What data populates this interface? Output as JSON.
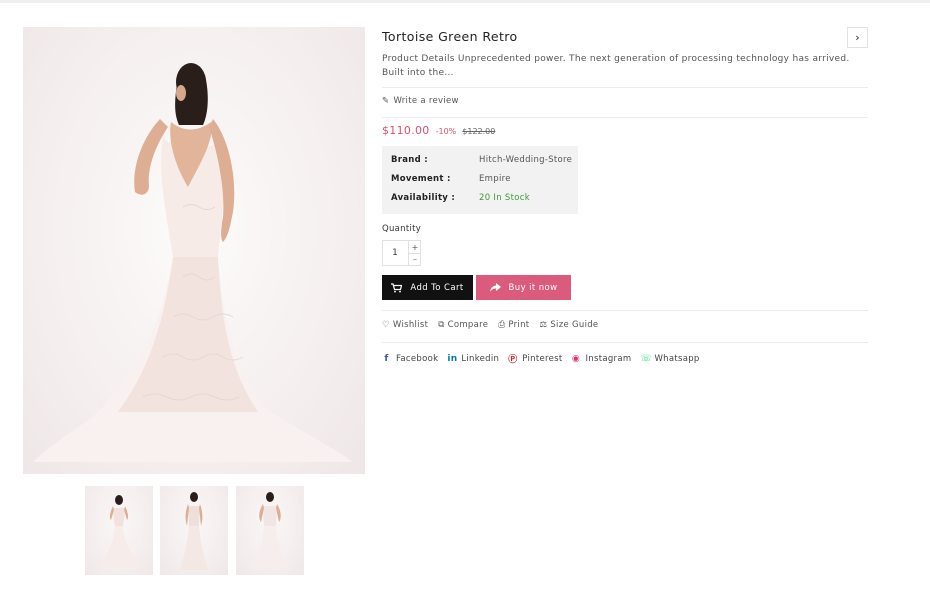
{
  "product": {
    "title": "Tortoise Green Retro",
    "description": "Product Details Unprecedented power. The next generation of processing technology has arrived. Built into the...",
    "review_link": "Write a review",
    "price": "$110.00",
    "discount": "-10%",
    "old_price": "$122.00",
    "specs": [
      {
        "label": "Brand :",
        "value": "Hitch-Wedding-Store"
      },
      {
        "label": "Movement :",
        "value": "Empire"
      },
      {
        "label": "Availability :",
        "value": "20 In Stock"
      }
    ],
    "quantity_label": "Quantity",
    "quantity_value": "1",
    "add_to_cart": "Add To Cart",
    "buy_now": "Buy it now"
  },
  "actions": {
    "wishlist": "Wishlist",
    "compare": "Compare",
    "print": "Print",
    "size_guide": "Size Guide"
  },
  "social": {
    "facebook": "Facebook",
    "linkedin": "Linkedin",
    "pinterest": "Pinterest",
    "instagram": "Instagram",
    "whatsapp": "Whatsapp"
  },
  "colors": {
    "price": "#d9506b",
    "buy_button": "#da5b7c",
    "cart_button": "#111111",
    "in_stock": "#3a9a3a",
    "facebook": "#3b5998",
    "linkedin": "#0077b5",
    "pinterest": "#cb2027",
    "instagram": "#e1306c",
    "whatsapp": "#25d366"
  },
  "icons": {
    "next": "chevron-right-icon",
    "review": "pencil-icon",
    "cart": "cart-icon",
    "buy": "share-arrow-icon",
    "wishlist": "heart-icon",
    "compare": "compare-icon",
    "print": "printer-icon",
    "size_guide": "size-guide-icon"
  }
}
